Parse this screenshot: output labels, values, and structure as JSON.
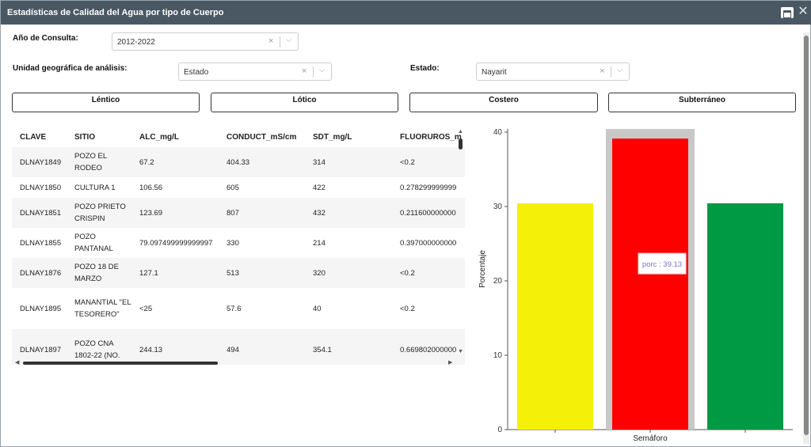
{
  "window": {
    "title": "Estadísticas de Calidad del Agua por tipo de Cuerpo"
  },
  "filters": {
    "year_label": "Año de Consulta:",
    "year_value": "2012-2022",
    "unit_label": "Unidad geográfica de análisis:",
    "unit_value": "Estado",
    "state_label": "Estado:",
    "state_value": "Nayarit",
    "clear_glyph": "×",
    "chevron_glyph": "⌵"
  },
  "body_buttons": [
    "Léntico",
    "Lótico",
    "Costero",
    "Subterráneo"
  ],
  "table": {
    "headers": [
      "CLAVE",
      "SITIO",
      "ALC_mg/L",
      "CONDUCT_mS/cm",
      "SDT_mg/L",
      "FLUORUROS_m"
    ],
    "rows": [
      [
        "DLNAY1849",
        "POZO EL RODEO",
        "67.2",
        "404.33",
        "314",
        "<0.2"
      ],
      [
        "DLNAY1850",
        "CULTURA 1",
        "106.56",
        "605",
        "422",
        "0.278299999999"
      ],
      [
        "DLNAY1851",
        "POZO PRIETO CRISPIN",
        "123.69",
        "807",
        "432",
        "0.211600000000"
      ],
      [
        "DLNAY1855",
        "POZO PANTANAL",
        "79.097499999999997",
        "330",
        "214",
        "0.397000000000"
      ],
      [
        "DLNAY1876",
        "POZO 18 DE MARZO",
        "127.1",
        "513",
        "320",
        "<0.2"
      ],
      [
        "DLNAY1895",
        "MANANTIAL \"EL TESORERO\"",
        "<25",
        "57.6",
        "40",
        "<0.2"
      ],
      [
        "DLNAY1897",
        "POZO CNA 1802-22 (NO.",
        "244.13",
        "494",
        "354.1",
        "0.669802000000"
      ]
    ]
  },
  "chart_data": {
    "type": "bar",
    "categories": [
      "",
      "",
      ""
    ],
    "values": [
      30.43,
      39.13,
      30.43
    ],
    "colors": [
      "#f5f007",
      "#ff0000",
      "#009944"
    ],
    "hover_color": "#c8c8c8",
    "ylabel": "Porcentaje",
    "xlabel": "Semáforo",
    "ylim": [
      0,
      40
    ],
    "yticks": [
      0,
      10,
      20,
      30,
      40
    ],
    "tooltip": {
      "text": "porc : 39.13",
      "index": 1
    },
    "grid": false
  }
}
